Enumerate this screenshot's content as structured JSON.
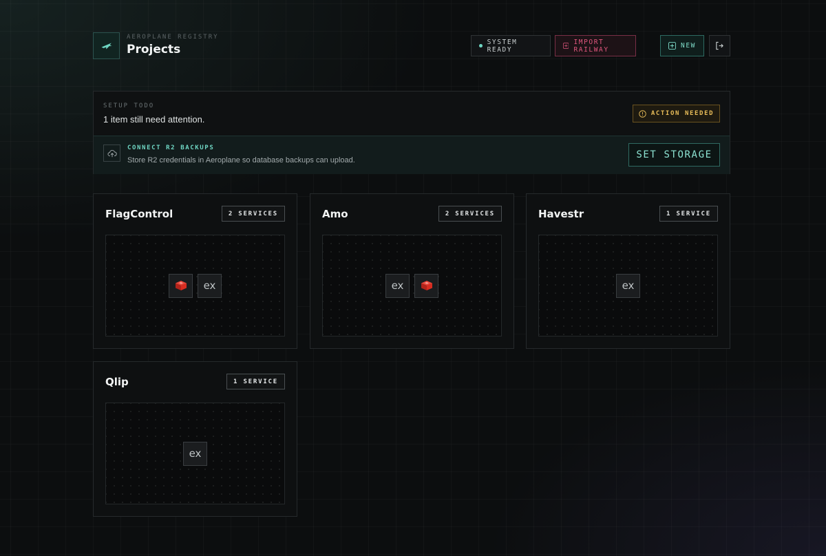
{
  "header": {
    "subtitle": "AEROPLANE REGISTRY",
    "title": "Projects",
    "status_label": "SYSTEM READY",
    "import_label": "IMPORT RAILWAY",
    "new_label": "NEW"
  },
  "setup": {
    "label": "SETUP TODO",
    "summary": "1 item still need attention.",
    "badge": "ACTION NEEDED",
    "item": {
      "title": "CONNECT R2 BACKUPS",
      "description": "Store R2 credentials in Aeroplane so database backups can upload.",
      "button_label": "SET STORAGE"
    }
  },
  "projects": [
    {
      "name": "FlagControl",
      "badge": "2 SERVICES",
      "services": [
        {
          "type": "redis-icon"
        },
        {
          "type": "express-icon",
          "text": "ex"
        }
      ]
    },
    {
      "name": "Amo",
      "badge": "2 SERVICES",
      "services": [
        {
          "type": "express-icon",
          "text": "ex"
        },
        {
          "type": "redis-icon"
        }
      ]
    },
    {
      "name": "Havestr",
      "badge": "1 SERVICE",
      "services": [
        {
          "type": "express-icon",
          "text": "ex"
        }
      ]
    },
    {
      "name": "Qlip",
      "badge": "1 SERVICE",
      "services": [
        {
          "type": "express-icon",
          "text": "ex"
        }
      ]
    }
  ],
  "colors": {
    "accent": "#6fd6c3",
    "import": "#e1577e",
    "warning": "#e9bd59",
    "redis": "#d82c20"
  }
}
